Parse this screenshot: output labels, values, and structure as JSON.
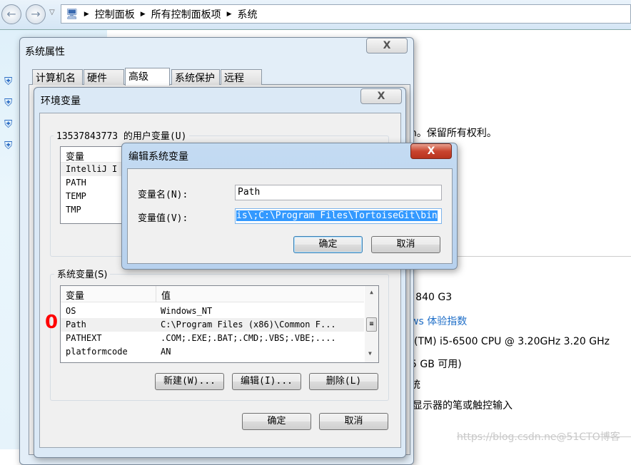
{
  "explorer": {
    "breadcrumb": [
      "控制面板",
      "所有控制面板项",
      "系统"
    ]
  },
  "background": {
    "copyright": "n。保留所有权利。",
    "model": ": 840 G3",
    "rating_link": "ws 体验指数",
    "cpu": "(TM) i5-6500 CPU @ 3.20GHz   3.20 GHz",
    "memory": "5 GB 可用)",
    "system_type": "统",
    "pen_touch": "显示器的笔或触控输入",
    "watermark": "https://blog.csdn.ne@51CTO博客"
  },
  "system_properties": {
    "title": "系统属性",
    "close": "X",
    "tabs": [
      {
        "label": "计算机名"
      },
      {
        "label": "硬件"
      },
      {
        "label": "高级",
        "selected": true
      },
      {
        "label": "系统保护"
      },
      {
        "label": "远程"
      }
    ]
  },
  "env_dialog": {
    "title": "环境变量",
    "user_group": "13537843773 的用户变量(U)",
    "user_header": "变量",
    "user_vars": [
      "IntelliJ I",
      "PATH",
      "TEMP",
      "TMP"
    ],
    "system_group": "系统变量(S)",
    "sys_headers": {
      "name": "变量",
      "value": "值"
    },
    "sys_vars": [
      {
        "name": "OS",
        "value": "Windows_NT"
      },
      {
        "name": "Path",
        "value": "C:\\Program Files (x86)\\Common F..."
      },
      {
        "name": "PATHEXT",
        "value": ".COM;.EXE;.BAT;.CMD;.VBS;.VBE;...."
      },
      {
        "name": "platformcode",
        "value": "AN"
      }
    ],
    "annotation": "0",
    "new_btn": "新建(W)...",
    "edit_btn": "编辑(I)...",
    "delete_btn": "删除(L)",
    "ok": "确定",
    "cancel": "取消"
  },
  "edit_dialog": {
    "title": "编辑系统变量",
    "close": "X",
    "name_label": "变量名(N):",
    "name_value": "Path",
    "value_label": "变量值(V):",
    "value_value": "is\\;C:\\Program Files\\TortoiseGit\\bin",
    "ok": "确定",
    "cancel": "取消"
  },
  "colors": {
    "selection": "#3399ff",
    "close_red": "#c9452f",
    "link": "#1e6ec8",
    "annotation": "#ff0000"
  }
}
